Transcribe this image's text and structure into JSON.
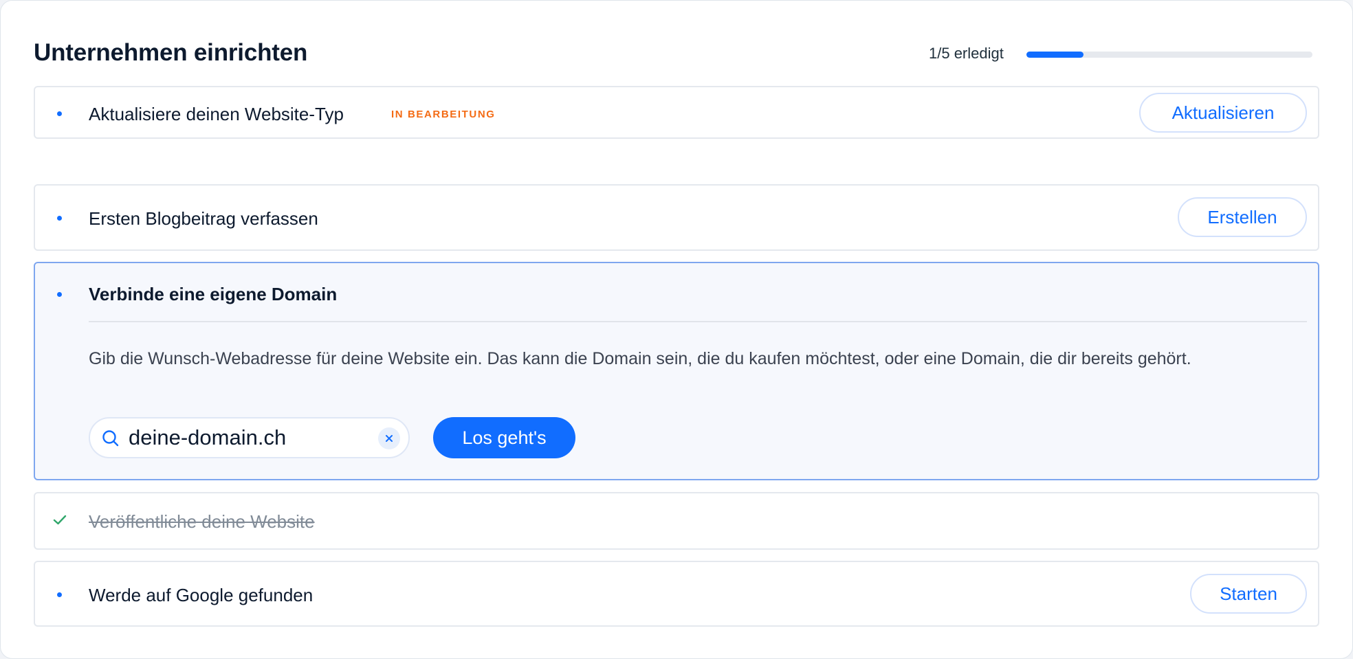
{
  "header": {
    "title": "Unternehmen einrichten",
    "progress_text": "1/5 erledigt",
    "progress_fraction": 0.2
  },
  "tasks": [
    {
      "label": "Aktualisiere deinen Website-Typ",
      "badge": "IN BEARBEITUNG",
      "button": "Aktualisieren",
      "status": "in-progress"
    },
    {
      "label": "Ersten Blogbeitrag verfassen",
      "button": "Erstellen",
      "status": "open"
    },
    {
      "label": "Verbinde eine eigene Domain",
      "status": "expanded",
      "description": "Gib die Wunsch-Webadresse für deine Website ein. Das kann die Domain sein, die du kaufen möchtest, oder eine Domain, die dir bereits gehört.",
      "search_value": "deine-domain.ch",
      "primary_button": "Los geht's"
    },
    {
      "label": "Veröffentliche deine Website",
      "status": "done"
    },
    {
      "label": "Werde auf Google gefunden",
      "button": "Starten",
      "status": "open"
    }
  ],
  "colors": {
    "accent": "#116dff",
    "badge": "#f46b14",
    "done_check": "#2fa66a"
  },
  "icons": [
    "search-icon",
    "clear-icon",
    "check-icon"
  ]
}
